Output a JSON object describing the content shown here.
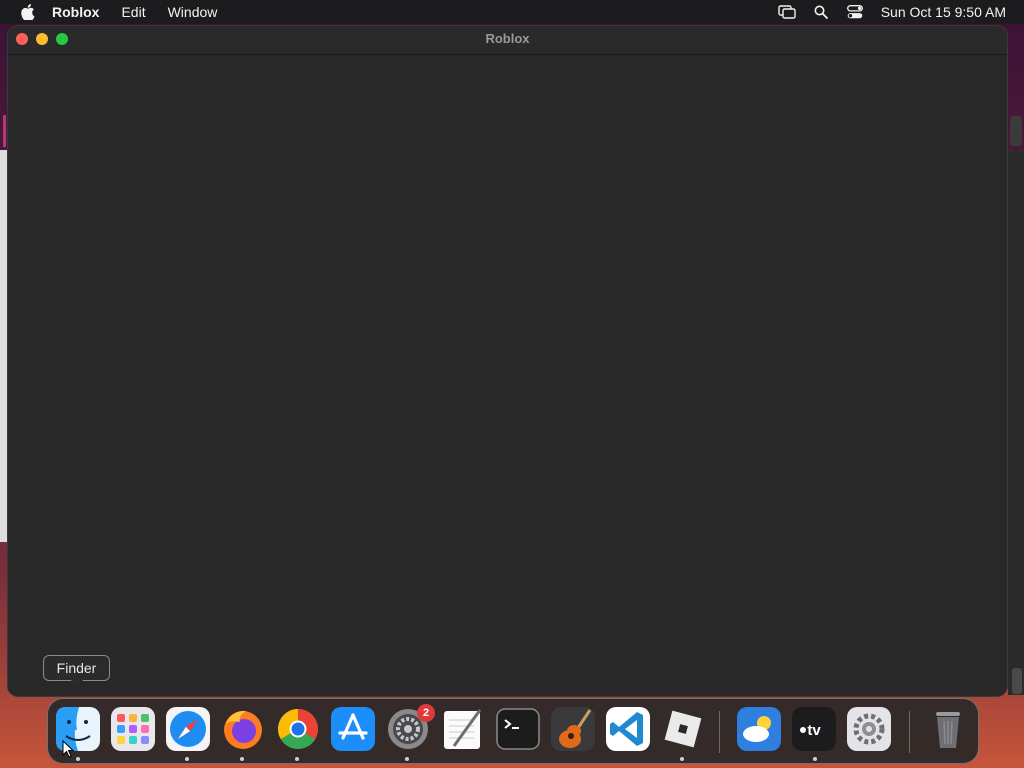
{
  "menubar": {
    "app_name": "Roblox",
    "menus": [
      "Edit",
      "Window"
    ],
    "clock": "Sun Oct 15  9:50 AM",
    "status_icons": [
      "screen-mirroring-icon",
      "spotlight-search-icon",
      "control-center-icon"
    ]
  },
  "window": {
    "title": "Roblox"
  },
  "tooltip": {
    "label": "Finder"
  },
  "dock": {
    "apps": [
      {
        "name": "Finder",
        "icon": "finder-icon",
        "running": true
      },
      {
        "name": "Launchpad",
        "icon": "launchpad-icon",
        "running": false
      },
      {
        "name": "Safari",
        "icon": "safari-icon",
        "running": true
      },
      {
        "name": "Firefox",
        "icon": "firefox-icon",
        "running": true
      },
      {
        "name": "Google Chrome",
        "icon": "chrome-icon",
        "running": true
      },
      {
        "name": "App Store",
        "icon": "app-store-icon",
        "running": false
      },
      {
        "name": "System Preferences",
        "icon": "system-preferences-icon",
        "running": true,
        "badge": "2"
      },
      {
        "name": "TextEdit",
        "icon": "textedit-icon",
        "running": false
      },
      {
        "name": "Terminal",
        "icon": "terminal-icon",
        "running": false
      },
      {
        "name": "GarageBand",
        "icon": "garageband-icon",
        "running": false
      },
      {
        "name": "Visual Studio Code",
        "icon": "vscode-icon",
        "running": false
      },
      {
        "name": "Roblox",
        "icon": "roblox-icon",
        "running": true
      },
      {
        "name": "Weather",
        "icon": "weather-icon",
        "running": false
      },
      {
        "name": "TV",
        "icon": "apple-tv-icon",
        "running": true
      },
      {
        "name": "Settings",
        "icon": "settings-gear-icon",
        "running": false
      },
      {
        "name": "Trash",
        "icon": "trash-icon",
        "running": false
      }
    ]
  }
}
